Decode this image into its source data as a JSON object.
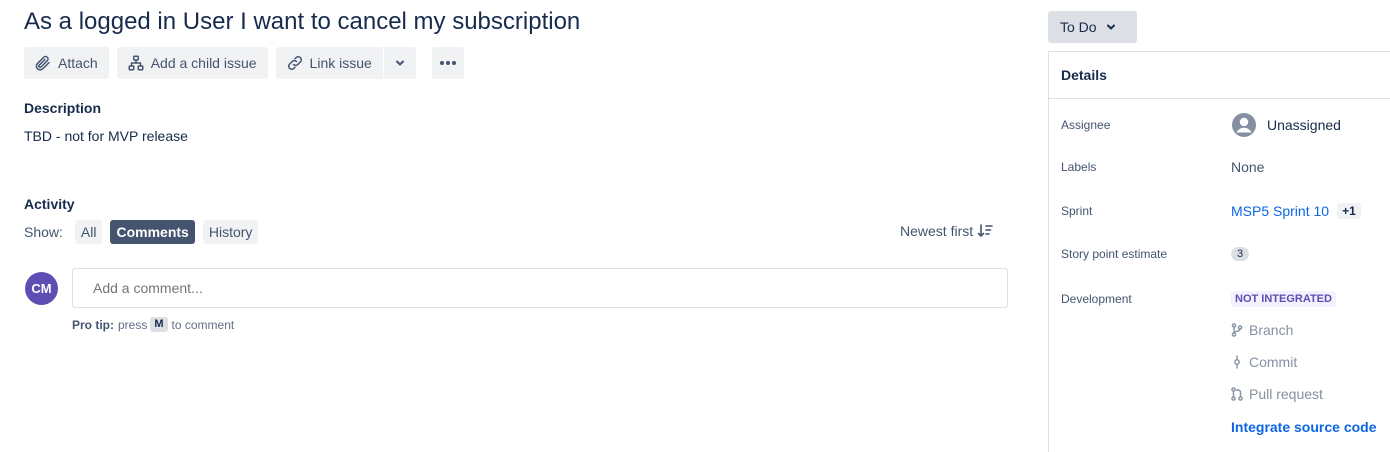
{
  "issue": {
    "title": "As a logged in User I want to cancel my subscription"
  },
  "toolbar": {
    "attach_label": "Attach",
    "add_child_label": "Add a child issue",
    "link_issue_label": "Link issue"
  },
  "description": {
    "label": "Description",
    "text": "TBD - not for MVP release"
  },
  "activity": {
    "label": "Activity",
    "show_label": "Show:",
    "filters": [
      "All",
      "Comments",
      "History"
    ],
    "active_filter": "Comments",
    "sort_label": "Newest first"
  },
  "comment": {
    "avatar_initials": "CM",
    "placeholder": "Add a comment...",
    "protip_label": "Pro tip:",
    "protip_press": "press",
    "protip_key": "M",
    "protip_suffix": "to comment"
  },
  "status": {
    "label": "To Do"
  },
  "details": {
    "header": "Details",
    "assignee_label": "Assignee",
    "assignee_value": "Unassigned",
    "labels_label": "Labels",
    "labels_value": "None",
    "sprint_label": "Sprint",
    "sprint_value": "MSP5 Sprint 10",
    "sprint_extra": "+1",
    "story_points_label": "Story point estimate",
    "story_points_value": "3",
    "development_label": "Development",
    "development_status": "NOT INTEGRATED",
    "branch_label": "Branch",
    "commit_label": "Commit",
    "pull_request_label": "Pull request",
    "integrate_label": "Integrate source code"
  },
  "colors": {
    "accent": "#0c66e4",
    "avatar": "#5e4db2",
    "active_filter_bg": "#44546f",
    "lozenge_text": "#5e4db2"
  },
  "icons": [
    "paperclip-icon",
    "child-issue-icon",
    "link-icon",
    "chevron-down-icon",
    "more-icon",
    "sort-icon",
    "user-avatar-icon",
    "branch-icon",
    "commit-icon",
    "pull-request-icon"
  ]
}
